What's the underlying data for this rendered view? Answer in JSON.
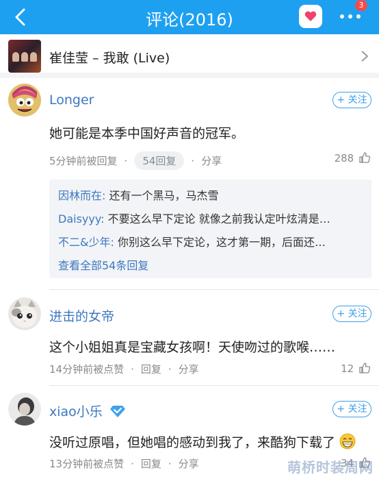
{
  "header": {
    "title": "评论(2016)",
    "more_badge": "3",
    "accent": "#1ea0f0"
  },
  "song": {
    "name": "崔佳莹 – 我敢 (Live)"
  },
  "comments": [
    {
      "user": "Longer",
      "follow": "+ 关注",
      "text": "她可能是本季中国好声音的冠军。",
      "time": "5分钟前被回复",
      "reply": "54回复",
      "share": "分享",
      "likes": "288",
      "replies": [
        {
          "who": "因林而在:",
          "text": "还有一个黑马，马杰雪"
        },
        {
          "who": "Daisyyy:",
          "text": "不要这么早下定论 就像之前我认定叶炫清是…"
        },
        {
          "who": "不二&少年:",
          "text": "你别这么早下定论，这才第一期，后面还…"
        }
      ],
      "view_all": "查看全部54条回复"
    },
    {
      "user": "进击的女帝",
      "follow": "+ 关注",
      "text": "这个小姐姐真是宝藏女孩啊！天使吻过的歌喉……",
      "time": "14分钟前被点赞",
      "reply": "回复",
      "share": "分享",
      "likes": "12"
    },
    {
      "user": "xiao小乐",
      "follow": "+ 关注",
      "text": "没听过原唱，但她唱的感动到我了，来酷狗下载了",
      "time": "13分钟前被点赞",
      "reply": "回复",
      "share": "分享",
      "likes": "34"
    }
  ],
  "watermark": "萌桥时装周网"
}
